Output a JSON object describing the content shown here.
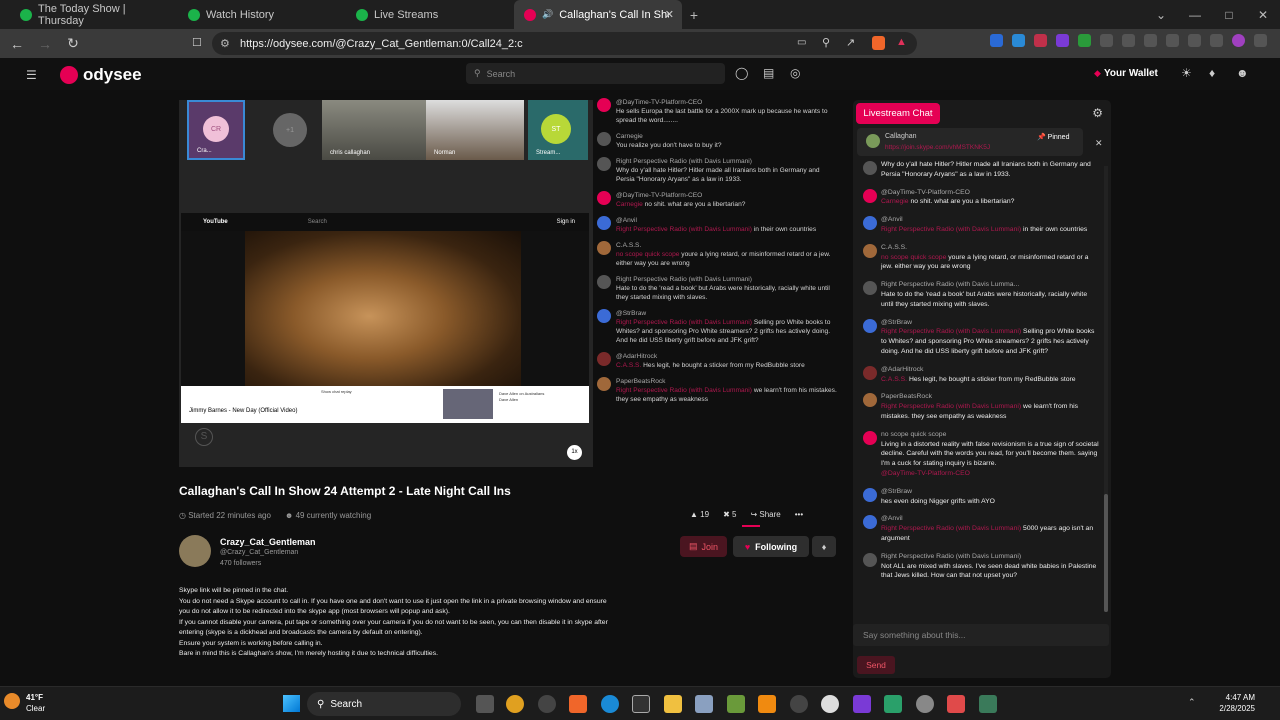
{
  "tabs": [
    {
      "label": "The Today Show | Thursday",
      "color": "#1bb34a"
    },
    {
      "label": "Watch History",
      "color": "#1bb34a"
    },
    {
      "label": "Live Streams",
      "color": "#1bb34a"
    },
    {
      "label": "Callaghan's Call In Show 24",
      "color": "#e50054"
    }
  ],
  "browser": {
    "url": "https://odysee.com/@Crazy_Cat_Gentleman:0/Call24_2:c",
    "new_tab": "+"
  },
  "site": {
    "logo": "odysee",
    "search_placeholder": "Search",
    "wallet": "Your Wallet"
  },
  "thumbs": [
    {
      "label": "Cra..."
    },
    {
      "label": "+1"
    },
    {
      "label": "chris callaghan"
    },
    {
      "label": "Norman"
    },
    {
      "label": "Stream..."
    }
  ],
  "thumb_initials": {
    "cr": "CR",
    "st": "ST"
  },
  "youtube": {
    "brand": "YouTube",
    "search": "Search",
    "signin": "Sign in",
    "title": "Jimmy Barnes - New Day (Official Video)",
    "subtitle": "Show chat replay",
    "side_title": "Dave Allen on Australians",
    "side_meta": "Dave Allen",
    "speed": "1x"
  },
  "chat_small": [
    {
      "author": "@DayTime-TV-Platform-CEO",
      "text": "He sells Europa the last battle for a 2000X mark up because he wants to spread the word........",
      "color": "#e50054"
    },
    {
      "author": "Carnegie",
      "text": "You realize you don't have to buy it?",
      "color": "#555"
    },
    {
      "author": "Right Perspective Radio (with Davis Lummani)",
      "text": "Why do y'all hate Hitler? Hitler made all Iranians both in Germany and Persia \"Honorary Aryans\" as a law in 1933.",
      "color": "#555"
    },
    {
      "author": "@DayTime-TV-Platform-CEO",
      "ref": "Carnegie",
      "text": "no shit. what are you a libertarian?",
      "color": "#e50054"
    },
    {
      "author": "@Anvil",
      "ref": "Right Perspective Radio (with Davis Lummani)",
      "text": "in their own countries",
      "color": "#3b6bd6"
    },
    {
      "author": "C.A.S.S.",
      "ref": "no scope quick scope",
      "text": "youre a lying retard, or misinformed retard or a jew. either way you are wrong",
      "color": "#a0683a"
    },
    {
      "author": "Right Perspective Radio (with Davis Lummani)",
      "text": "Hate to do the 'read a book' but Arabs were historically, racially white until they started mixing with slaves.",
      "color": "#555"
    },
    {
      "author": "@StrBraw",
      "ref": "Right Perspective Radio (with Davis Lummani)",
      "text": "Selling pro White books to Whites? and sponsoring Pro White streamers? 2 grifts hes actively doing. And he did USS liberty grift before and JFK grift?",
      "color": "#3b6bd6"
    },
    {
      "author": "@AdarHitrock",
      "ref": "C.A.S.S.",
      "text": "Hes legit, he bought a sticker from my RedBubble store",
      "color": "#7a2a2a"
    },
    {
      "author": "PaperBeatsRock",
      "ref": "Right Perspective Radio (with Davis Lummani)",
      "text": "we learn't from his mistakes. they see empathy as weakness",
      "color": "#a0683a"
    }
  ],
  "video": {
    "title": "Callaghan's Call In Show 24 Attempt 2 - Late Night Call Ins",
    "started": "Started 22 minutes ago",
    "watching": "49 currently watching",
    "likes": "19",
    "boosts": "5",
    "share": "Share",
    "more": "•••"
  },
  "channel": {
    "name": "Crazy_Cat_Gentleman",
    "handle": "@Crazy_Cat_Gentleman",
    "followers": "470 followers",
    "join": "Join",
    "following": "Following"
  },
  "description": [
    "Skype link will be pinned in the chat.",
    "You do not need a Skype account to call in. If you have one and don't want to use it just open the link in a private browsing window and ensure you do not allow it to be redirected into the skype app (most browsers will popup and ask).",
    "If you cannot disable your camera, put tape or something over your camera if you do not want to be seen, you can then disable it in skype after entering (skype is a dickhead and broadcasts the camera by default on entering).",
    "Ensure your system is working before calling in.",
    "Bare in mind this is Callaghan's show, I'm merely hosting it due to technical difficulties."
  ],
  "livechat": {
    "title": "Livestream Chat",
    "pinned_author": "Callaghan",
    "pinned_link": "https://join.skype.com/vhMSTKNK5J",
    "pinned_label": "Pinned",
    "placeholder": "Say something about this...",
    "send": "Send",
    "messages": [
      {
        "author": "",
        "text": "Why do y'all hate Hitler? Hitler made all Iranians both in Germany and Persia \"Honorary Aryans\" as a law in 1933.",
        "color": "#555"
      },
      {
        "author": "@DayTime-TV-Platform-CEO",
        "ref": "Carnegie",
        "text": "no shit. what are you a libertarian?",
        "color": "#e50054"
      },
      {
        "author": "@Anvil",
        "ref": "Right Perspective Radio (with Davis Lummani)",
        "text": "in their own countries",
        "color": "#3b6bd6"
      },
      {
        "author": "C.A.S.S.",
        "ref": "no scope quick scope",
        "text": "youre a lying retard, or misinformed retard or a jew. either way you are wrong",
        "color": "#a0683a"
      },
      {
        "author": "Right Perspective Radio (with Davis Lumma...",
        "text": "Hate to do the 'read a book' but Arabs were historically, racially white until they started mixing with slaves.",
        "color": "#555"
      },
      {
        "author": "@StrBraw",
        "ref": "Right Perspective Radio (with Davis Lummani)",
        "text": "Selling pro White books to Whites? and sponsoring Pro White streamers? 2 grifts hes actively doing. And he did USS liberty grift before and JFK grift?",
        "color": "#3b6bd6"
      },
      {
        "author": "@AdarHitrock",
        "ref": "C.A.S.S.",
        "text": "Hes legit, he bought a sticker from my RedBubble store",
        "color": "#7a2a2a"
      },
      {
        "author": "PaperBeatsRock",
        "ref": "Right Perspective Radio (with Davis Lummani)",
        "text": "we learn't from his mistakes. they see empathy as weakness",
        "color": "#a0683a"
      },
      {
        "author": "no scope quick scope",
        "text": "Living in a distorted reality with false revisionism is a true sign of societal decline. Careful with the words you read, for you'll become them. saying I'm a cuck for stating inquiry is bizarre.",
        "ref2": "@DayTime-TV-Platform-CEO",
        "color": "#e50054"
      },
      {
        "author": "@StrBraw",
        "text": "hes even doing Nigger grifts with AYO",
        "color": "#3b6bd6"
      },
      {
        "author": "@Anvil",
        "ref": "Right Perspective Radio (with Davis Lummani)",
        "text": "5000 years ago isn't an argument",
        "color": "#3b6bd6"
      },
      {
        "author": "Right Perspective Radio (with Davis Lummani)",
        "text": "Not ALL are mixed with slaves. I've seen dead white babies in Palestine that Jews killed. How can that not upset you?",
        "color": "#555"
      }
    ]
  },
  "taskbar": {
    "temp": "41°F",
    "condition": "Clear",
    "search": "Search",
    "time": "4:47 AM",
    "date": "2/28/2025"
  }
}
